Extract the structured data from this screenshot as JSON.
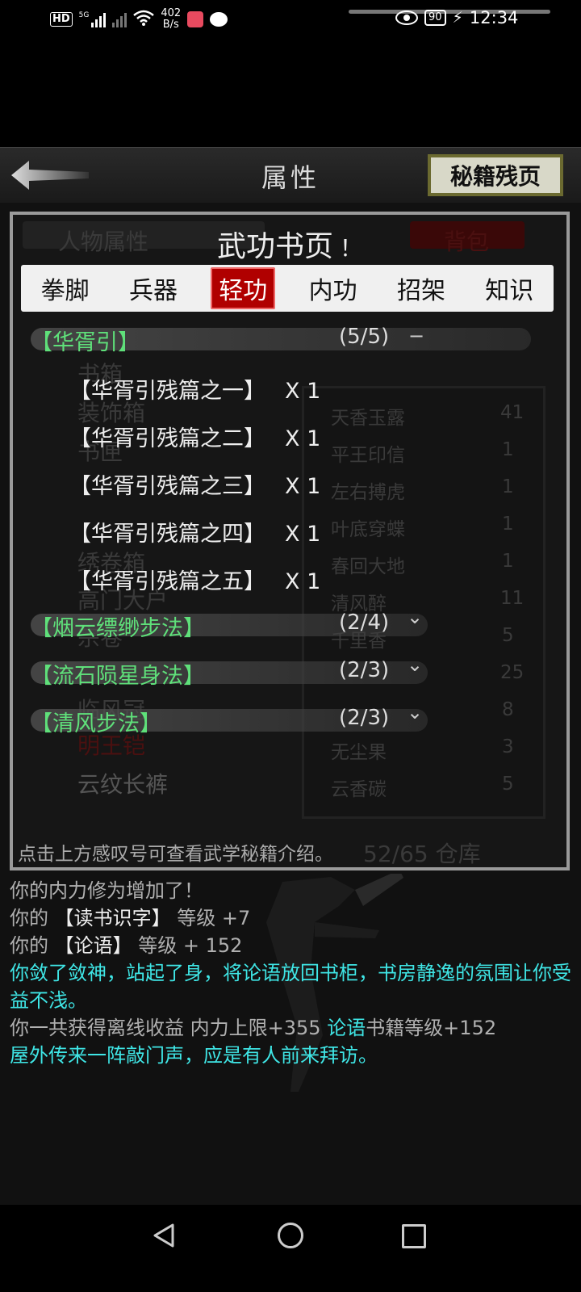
{
  "status_bar": {
    "hd": "HD",
    "sim1_tag": "5G",
    "net_speed_value": "402",
    "net_speed_unit": "B/s",
    "battery": "90",
    "time": "12:34"
  },
  "header": {
    "title": "属性",
    "pages_button": "秘籍残页"
  },
  "panel": {
    "title": "武功书页",
    "info_mark": "！",
    "tabs": [
      {
        "label": "拳脚",
        "active": false
      },
      {
        "label": "兵器",
        "active": false
      },
      {
        "label": "轻功",
        "active": true
      },
      {
        "label": "内功",
        "active": false
      },
      {
        "label": "招架",
        "active": false
      },
      {
        "label": "知识",
        "active": false
      }
    ],
    "categories": [
      {
        "name": "【华胥引】",
        "count": "(5/5)",
        "toggle": "−",
        "entries": [
          {
            "name": "【华胥引残篇之一】",
            "qty": "X 1"
          },
          {
            "name": "【华胥引残篇之二】",
            "qty": "X 1"
          },
          {
            "name": "【华胥引残篇之三】",
            "qty": "X 1"
          },
          {
            "name": "【华胥引残篇之四】",
            "qty": "X 1"
          },
          {
            "name": "【华胥引残篇之五】",
            "qty": "X 1"
          }
        ]
      },
      {
        "name": "【烟云缥缈步法】",
        "count": "(2/4)",
        "toggle": "⌄"
      },
      {
        "name": "【流石陨星身法】",
        "count": "(2/3)",
        "toggle": "⌄"
      },
      {
        "name": "【清风步法】",
        "count": "(2/3)",
        "toggle": "⌄"
      }
    ],
    "hint": "点击上方感叹号可查看武学秘籍介绍。"
  },
  "background_ghost": {
    "tab_left": "人物属性",
    "tab_right": "背包",
    "items_left": [
      "书箱",
      "装饰箱",
      "书匣",
      "绣卷箱",
      "高门大户",
      "宗卷",
      "临风冠",
      "明王铠",
      "云纹长裤"
    ],
    "items_right": [
      "天香玉露",
      "平王印信",
      "左右搏虎",
      "叶底穿蝶",
      "春回大地",
      "清风醉",
      "千里香",
      "无尘果",
      "云香碳"
    ],
    "counts_right": [
      "41",
      "1",
      "1",
      "1",
      "1",
      "11",
      "5",
      "25",
      "8",
      "3",
      "5"
    ],
    "storage": "52/65 仓库"
  },
  "log": [
    {
      "parts": [
        {
          "text": "你的内力修为增加了！",
          "color": "gray"
        }
      ]
    },
    {
      "parts": [
        {
          "text": "你的",
          "color": "gray"
        },
        {
          "text": " 【读书识字】",
          "color": "white"
        },
        {
          "text": " 等级 +7",
          "color": "gray"
        }
      ]
    },
    {
      "parts": [
        {
          "text": "你的",
          "color": "gray"
        },
        {
          "text": " 【论语】",
          "color": "white"
        },
        {
          "text": " 等级 + 152",
          "color": "gray"
        }
      ]
    },
    {
      "parts": [
        {
          "text": "你敛了敛神，站起了身，将论语放回书柜，书房静逸的氛围让你受益不浅。",
          "color": "cyan"
        }
      ]
    },
    {
      "parts": [
        {
          "text": "你一共获得离线收益 内力上限+355 ",
          "color": "gray"
        },
        {
          "text": "论语",
          "color": "cyan"
        },
        {
          "text": "书籍等级+152",
          "color": "gray"
        }
      ]
    },
    {
      "parts": [
        {
          "text": "屋外传来一阵敲门声，应是有人前来拜访。",
          "color": "cyan"
        }
      ]
    }
  ]
}
